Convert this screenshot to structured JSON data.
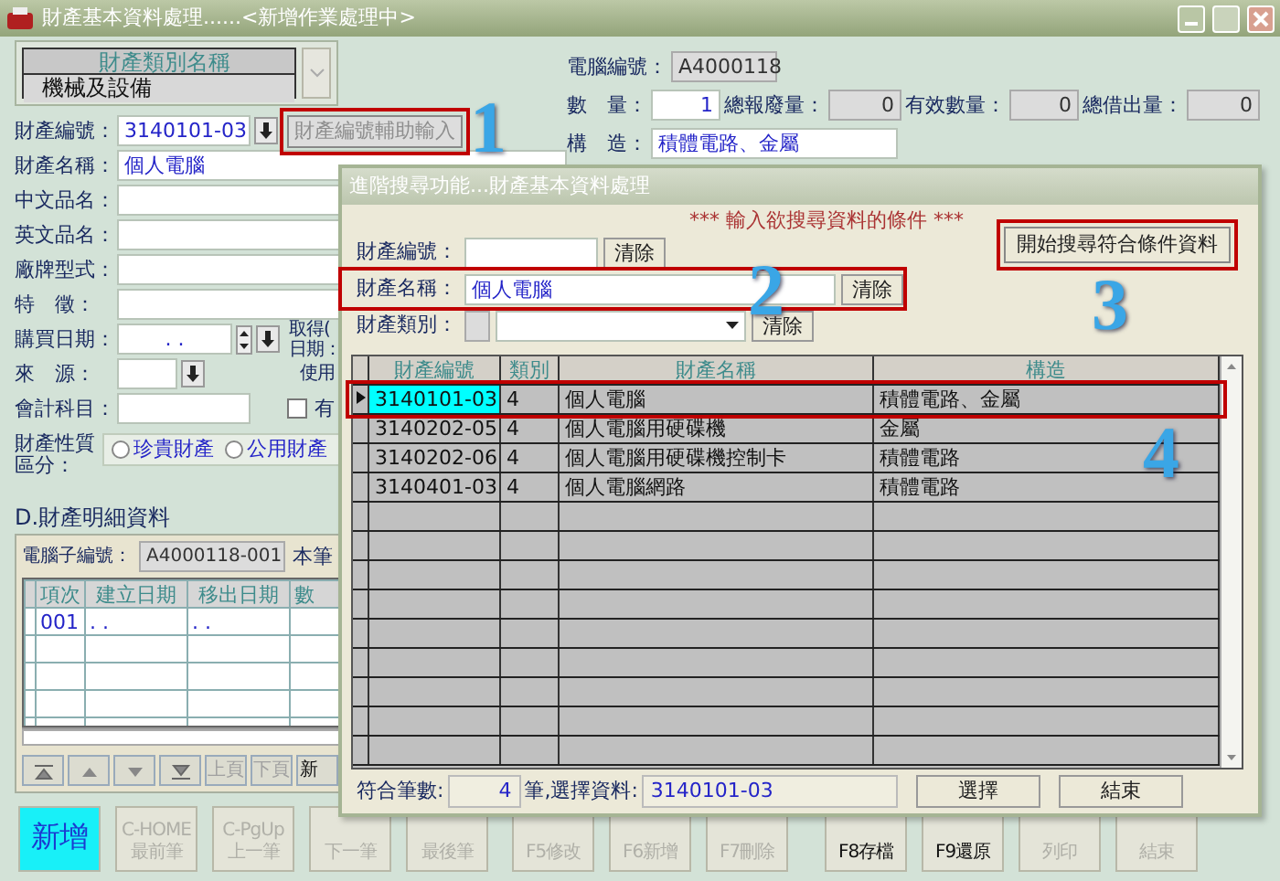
{
  "window": {
    "title": "財產基本資料處理......<新增作業處理中>"
  },
  "category_grid": {
    "header": "財產類別名稱",
    "value": "機械及設備"
  },
  "fields": [
    {
      "label": "財產編號：",
      "value": "3140101-03",
      "kind": "lookup",
      "assist_button": {
        "label": "財產編號輔助輸入",
        "disabled": true
      }
    },
    {
      "label": "財產名稱：",
      "value": "個人電腦",
      "kind": "text"
    },
    {
      "label": "中文品名：",
      "kind": "text"
    },
    {
      "label": "英文品名：",
      "kind": "text"
    },
    {
      "label": "廠牌型式：",
      "kind": "text"
    },
    {
      "label": "特　徵：",
      "kind": "text"
    },
    {
      "label": "購買日期：",
      "value": ".  .",
      "kind": "date",
      "side_labels": [
        "取得(",
        "日期："
      ]
    },
    {
      "label": "來　源：",
      "kind": "source",
      "side_labels": [
        "使用"
      ]
    },
    {
      "label": "會計科目：",
      "kind": "check",
      "checkbox": {
        "label": "有",
        "checked": false
      }
    }
  ],
  "info_fields": [
    {
      "label": "電腦編號：",
      "value": "A4000118",
      "kind": "readonly"
    },
    {
      "label": "數　量：",
      "value": "1",
      "kind": "number"
    },
    {
      "label": "總報廢量：",
      "value": "0",
      "kind": "readonly"
    },
    {
      "label": "有效數量：",
      "value": "0",
      "kind": "readonly"
    },
    {
      "label": "總借出量：",
      "value": "0",
      "kind": "readonly"
    },
    {
      "label": "構　造：",
      "value": "積體電路、金屬",
      "kind": "text"
    }
  ],
  "property_type": {
    "label": "財產性質區分：",
    "options": [
      {
        "label": "珍貴財產",
        "selected": false
      },
      {
        "label": "公用財產",
        "selected": false
      }
    ]
  },
  "detail": {
    "title": "D.財產明細資料",
    "sub_number_label": "電腦子編號：",
    "sub_number": "A4000118-001",
    "count_label": "本筆",
    "columns": [
      "項次",
      "建立日期",
      "移出日期",
      "數"
    ],
    "rows": [
      [
        "001",
        ".  .",
        ".  ."
      ]
    ],
    "page_buttons": [
      {
        "label": "上頁",
        "disabled": true
      },
      {
        "label": "下頁",
        "disabled": true
      },
      {
        "label": "新",
        "disabled": false
      }
    ]
  },
  "toolbar": [
    {
      "lines": [
        "新增"
      ],
      "active": true,
      "disabled": false
    },
    {
      "lines": [
        "C-HOME",
        "最前筆"
      ],
      "active": false,
      "disabled": true
    },
    {
      "lines": [
        "C-PgUp",
        "上一筆"
      ],
      "active": false,
      "disabled": true
    },
    {
      "lines": [
        "下一筆"
      ],
      "active": false,
      "disabled": true
    },
    {
      "lines": [
        "最後筆"
      ],
      "active": false,
      "disabled": true
    },
    {
      "lines": [
        "F5修改"
      ],
      "active": false,
      "disabled": true
    },
    {
      "lines": [
        "F6新增"
      ],
      "active": false,
      "disabled": true
    },
    {
      "lines": [
        "F7刪除"
      ],
      "active": false,
      "disabled": true
    },
    {
      "lines": [
        "F8存檔"
      ],
      "active": false,
      "disabled": false
    },
    {
      "lines": [
        "F9還原"
      ],
      "active": false,
      "disabled": false
    },
    {
      "lines": [
        "列印"
      ],
      "active": false,
      "disabled": true
    },
    {
      "lines": [
        "結束"
      ],
      "active": false,
      "disabled": true
    }
  ],
  "dialog": {
    "title": "進階搜尋功能...財產基本資料處理",
    "heading": "*** 輸入欲搜尋資料的條件 ***",
    "criteria": [
      {
        "label": "財產編號：",
        "kind": "text",
        "clear": "清除"
      },
      {
        "label": "財產名稱：",
        "kind": "text",
        "value": "個人電腦",
        "clear": "清除"
      },
      {
        "label": "財產類別：",
        "kind": "select",
        "clear": "清除"
      }
    ],
    "search_button": "開始搜尋符合條件資料",
    "columns": [
      "財產編號",
      "類別",
      "財產名稱",
      "構造"
    ],
    "rows": [
      {
        "cells": [
          "3140101-03",
          "4",
          "個人電腦",
          "積體電路、金屬"
        ],
        "selected": true
      },
      {
        "cells": [
          "3140202-05",
          "4",
          "個人電腦用硬碟機",
          "金屬"
        ],
        "selected": false
      },
      {
        "cells": [
          "3140202-06",
          "4",
          "個人電腦用硬碟機控制卡",
          "積體電路"
        ],
        "selected": false
      },
      {
        "cells": [
          "3140401-03",
          "4",
          "個人電腦網路",
          "積體電路"
        ],
        "selected": false
      }
    ],
    "count_label": "符合筆數:",
    "count": "4",
    "selected_label": "筆,選擇資料:",
    "selected_value": "3140101-03",
    "buttons": [
      "選擇",
      "結束"
    ]
  },
  "annotations": [
    {
      "number": "1"
    },
    {
      "number": "2"
    },
    {
      "number": "3"
    },
    {
      "number": "4"
    }
  ]
}
